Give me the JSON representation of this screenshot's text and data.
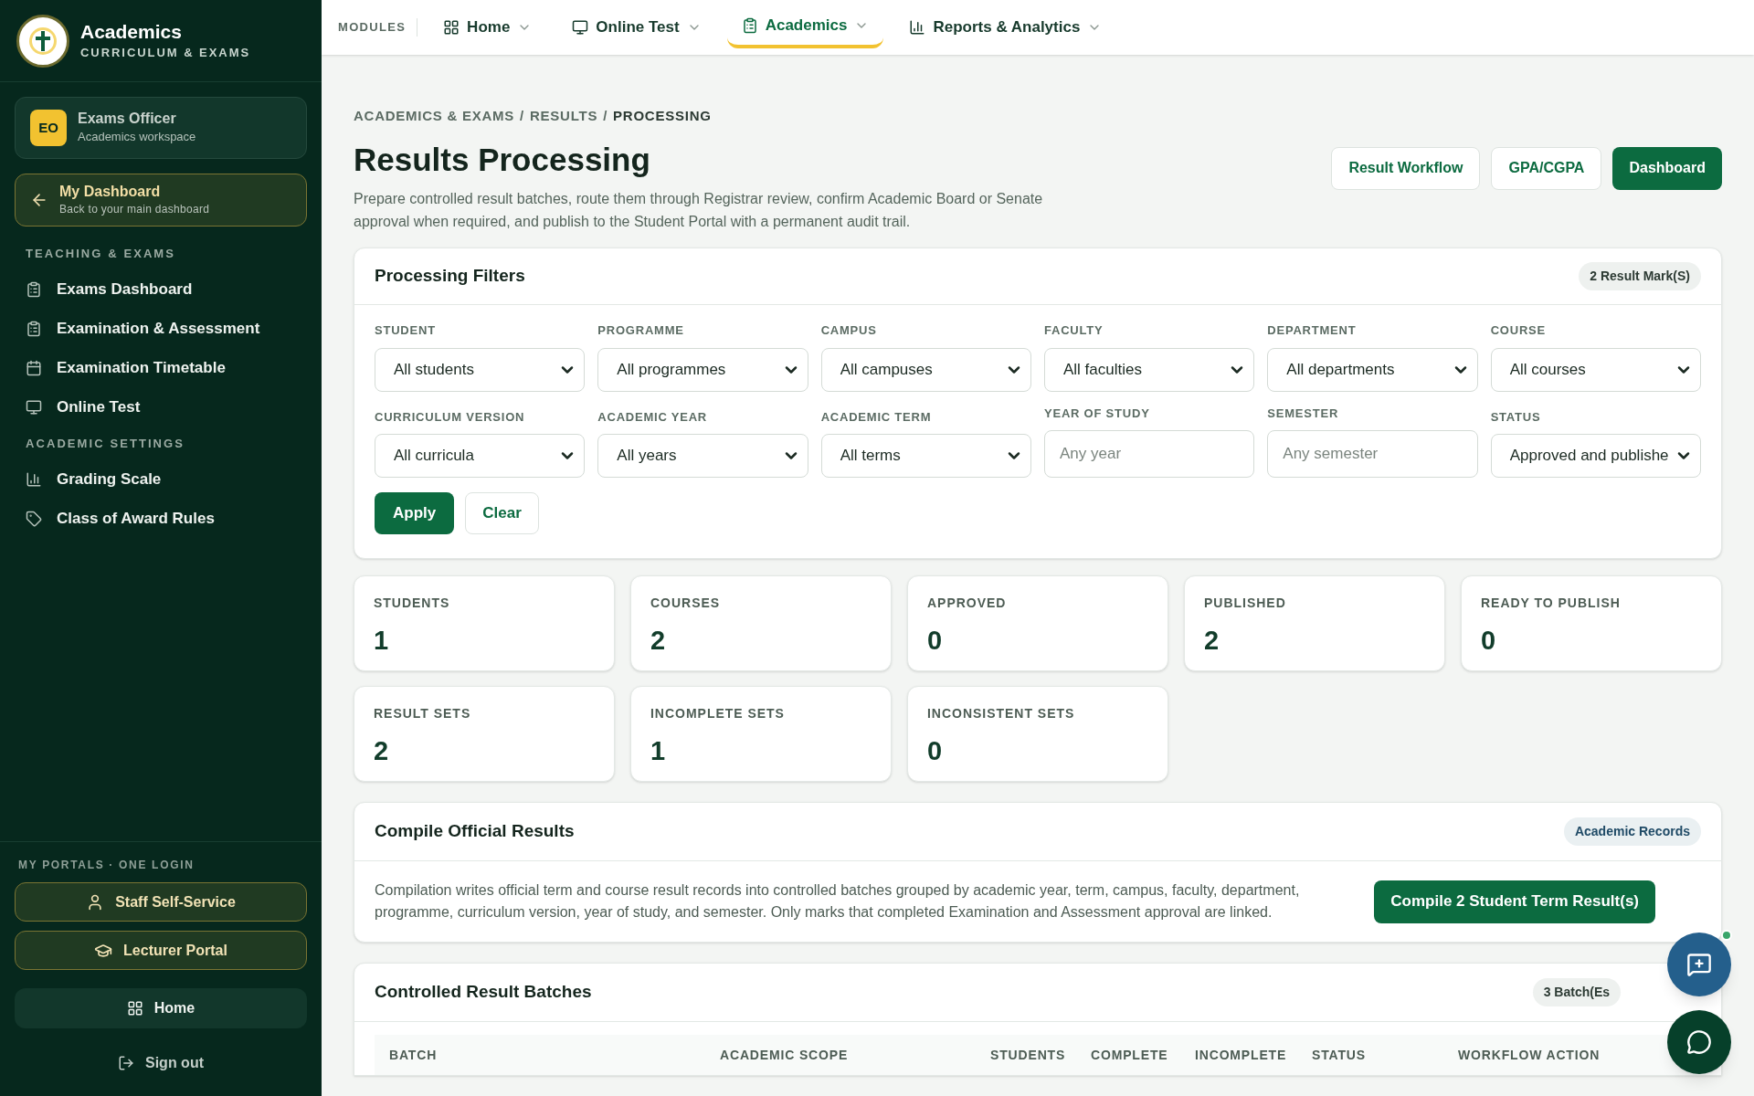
{
  "sidebar": {
    "brand": {
      "title": "Academics",
      "subtitle": "CURRICULUM & EXAMS"
    },
    "user": {
      "initials": "EO",
      "name": "Exams Officer",
      "workspace": "Academics workspace"
    },
    "back_link": {
      "title": "My Dashboard",
      "subtitle": "Back to your main dashboard"
    },
    "sections": [
      {
        "heading": "TEACHING & EXAMS",
        "items": [
          {
            "label": "Exams Dashboard",
            "kind": "clipboard"
          },
          {
            "label": "Examination & Assessment",
            "kind": "clipboard"
          },
          {
            "label": "Examination Timetable",
            "kind": "calendar"
          },
          {
            "label": "Online Test",
            "kind": "monitor"
          }
        ]
      },
      {
        "heading": "ACADEMIC SETTINGS",
        "items": [
          {
            "label": "Grading Scale",
            "kind": "chart"
          },
          {
            "label": "Class of Award Rules",
            "kind": "tag"
          }
        ]
      }
    ],
    "portals": {
      "heading": "MY PORTALS · ONE LOGIN",
      "links": [
        {
          "label": "Staff Self-Service",
          "kind": "user"
        },
        {
          "label": "Lecturer Portal",
          "kind": "cap"
        }
      ]
    },
    "home": "Home",
    "sign_out": "Sign out"
  },
  "topnav": {
    "label": "MODULES",
    "items": [
      {
        "label": "Home",
        "kind": "grid",
        "selected": false
      },
      {
        "label": "Online Test",
        "kind": "monitor",
        "selected": false
      },
      {
        "label": "Academics",
        "kind": "clipboard",
        "selected": true
      },
      {
        "label": "Reports & Analytics",
        "kind": "chart",
        "selected": false
      }
    ]
  },
  "breadcrumb": {
    "separator": "/",
    "parts": [
      "ACADEMICS & EXAMS",
      "RESULTS",
      "PROCESSING"
    ]
  },
  "header": {
    "title": "Results Processing",
    "description": "Prepare controlled result batches, route them through Registrar review, confirm Academic Board or Senate approval when required, and publish to the Student Portal with a permanent audit trail.",
    "buttons": [
      {
        "label": "Result Workflow",
        "primary": false
      },
      {
        "label": "GPA/CGPA",
        "primary": false
      },
      {
        "label": "Dashboard",
        "primary": true
      }
    ]
  },
  "filters": {
    "title": "Processing Filters",
    "badge": "2 Result Mark(S)",
    "fields": [
      {
        "label": "STUDENT",
        "kind": "select",
        "value": "All students"
      },
      {
        "label": "PROGRAMME",
        "kind": "select",
        "value": "All programmes"
      },
      {
        "label": "CAMPUS",
        "kind": "select",
        "value": "All campuses"
      },
      {
        "label": "FACULTY",
        "kind": "select",
        "value": "All faculties"
      },
      {
        "label": "DEPARTMENT",
        "kind": "select",
        "value": "All departments"
      },
      {
        "label": "COURSE",
        "kind": "select",
        "value": "All courses"
      },
      {
        "label": "CURRICULUM VERSION",
        "kind": "select",
        "value": "All curricula"
      },
      {
        "label": "ACADEMIC YEAR",
        "kind": "select",
        "value": "All years"
      },
      {
        "label": "ACADEMIC TERM",
        "kind": "select",
        "value": "All terms"
      },
      {
        "label": "YEAR OF STUDY",
        "kind": "input",
        "placeholder": "Any year"
      },
      {
        "label": "SEMESTER",
        "kind": "input",
        "placeholder": "Any semester"
      },
      {
        "label": "STATUS",
        "kind": "select",
        "value": "Approved and publishe"
      }
    ],
    "apply": "Apply",
    "clear": "Clear"
  },
  "stats": [
    {
      "label": "STUDENTS",
      "value": "1"
    },
    {
      "label": "COURSES",
      "value": "2"
    },
    {
      "label": "APPROVED",
      "value": "0"
    },
    {
      "label": "PUBLISHED",
      "value": "2"
    },
    {
      "label": "READY TO PUBLISH",
      "value": "0"
    },
    {
      "label": "RESULT SETS",
      "value": "2"
    },
    {
      "label": "INCOMPLETE SETS",
      "value": "1"
    },
    {
      "label": "INCONSISTENT SETS",
      "value": "0"
    }
  ],
  "compile": {
    "title": "Compile Official Results",
    "badge": "Academic Records",
    "text": "Compilation writes official term and course result records into controlled batches grouped by academic year, term, campus, faculty, department, programme, curriculum version, year of study, and semester. Only marks that completed Examination and Assessment approval are linked.",
    "button": "Compile 2 Student Term Result(s)"
  },
  "batches": {
    "title": "Controlled Result Batches",
    "badge": "3 Batch(Es",
    "columns": [
      "BATCH",
      "ACADEMIC SCOPE",
      "STUDENTS",
      "COMPLETE",
      "INCOMPLETE",
      "STATUS",
      "WORKFLOW ACTION"
    ]
  }
}
